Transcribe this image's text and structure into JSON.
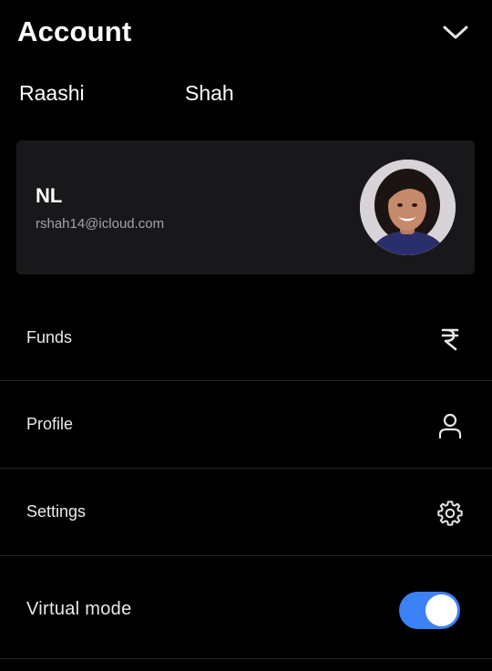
{
  "header": {
    "title": "Account",
    "collapse_icon": "chevron-down-icon"
  },
  "user": {
    "first_name": "Raashi",
    "last_name": "Shah",
    "initials": "NL",
    "email": "rshah14@icloud.com"
  },
  "menu": [
    {
      "label": "Funds",
      "icon": "rupee-icon"
    },
    {
      "label": "Profile",
      "icon": "user-icon"
    },
    {
      "label": "Settings",
      "icon": "gear-icon"
    }
  ],
  "virtual_mode": {
    "label": "Virtual mode",
    "enabled": true,
    "accent_color": "#3b82f6"
  },
  "colors": {
    "background": "#000000",
    "card": "#18181b",
    "divider": "#262629"
  }
}
